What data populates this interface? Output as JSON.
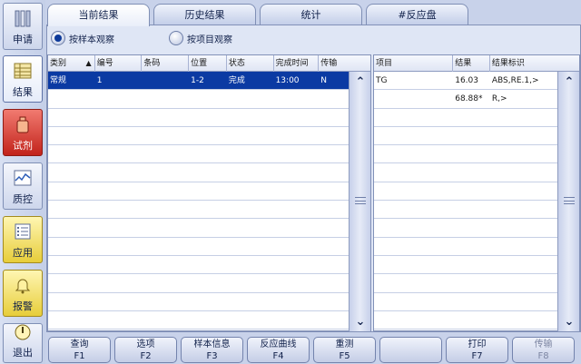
{
  "nav": [
    {
      "label": "申请",
      "icon": "books-icon"
    },
    {
      "label": "结果",
      "icon": "result-sheet-icon"
    },
    {
      "label": "试剂",
      "icon": "reagent-bottle-icon"
    },
    {
      "label": "质控",
      "icon": "qc-chart-icon"
    },
    {
      "label": "应用",
      "icon": "application-list-icon"
    },
    {
      "label": "报警",
      "icon": "alarm-bell-icon"
    },
    {
      "label": "退出",
      "icon": "power-icon"
    }
  ],
  "tabs": [
    "当前结果",
    "历史结果",
    "统计",
    "#反应盘"
  ],
  "view_options": {
    "by_sample": "按样本观察",
    "by_item": "按项目观察"
  },
  "sample_table": {
    "columns": [
      "类别",
      "编号",
      "条码",
      "位置",
      "状态",
      "完成时间",
      "传输"
    ],
    "rows": [
      [
        "常规",
        "1",
        "",
        "1-2",
        "完成",
        "13:00",
        "N"
      ]
    ]
  },
  "result_table": {
    "columns": [
      "项目",
      "结果",
      "结果标识"
    ],
    "rows": [
      [
        "TG",
        "16.03",
        "ABS,RE.1,>"
      ],
      [
        "",
        "68.88*",
        "R,>"
      ]
    ]
  },
  "function_keys": [
    {
      "label": "查询",
      "key": "F1"
    },
    {
      "label": "选项",
      "key": "F2"
    },
    {
      "label": "样本信息",
      "key": "F3"
    },
    {
      "label": "反应曲线",
      "key": "F4"
    },
    {
      "label": "重测",
      "key": "F5"
    },
    {
      "label": "",
      "key": ""
    },
    {
      "label": "打印",
      "key": "F7"
    },
    {
      "label": "传输",
      "key": "F8"
    }
  ]
}
